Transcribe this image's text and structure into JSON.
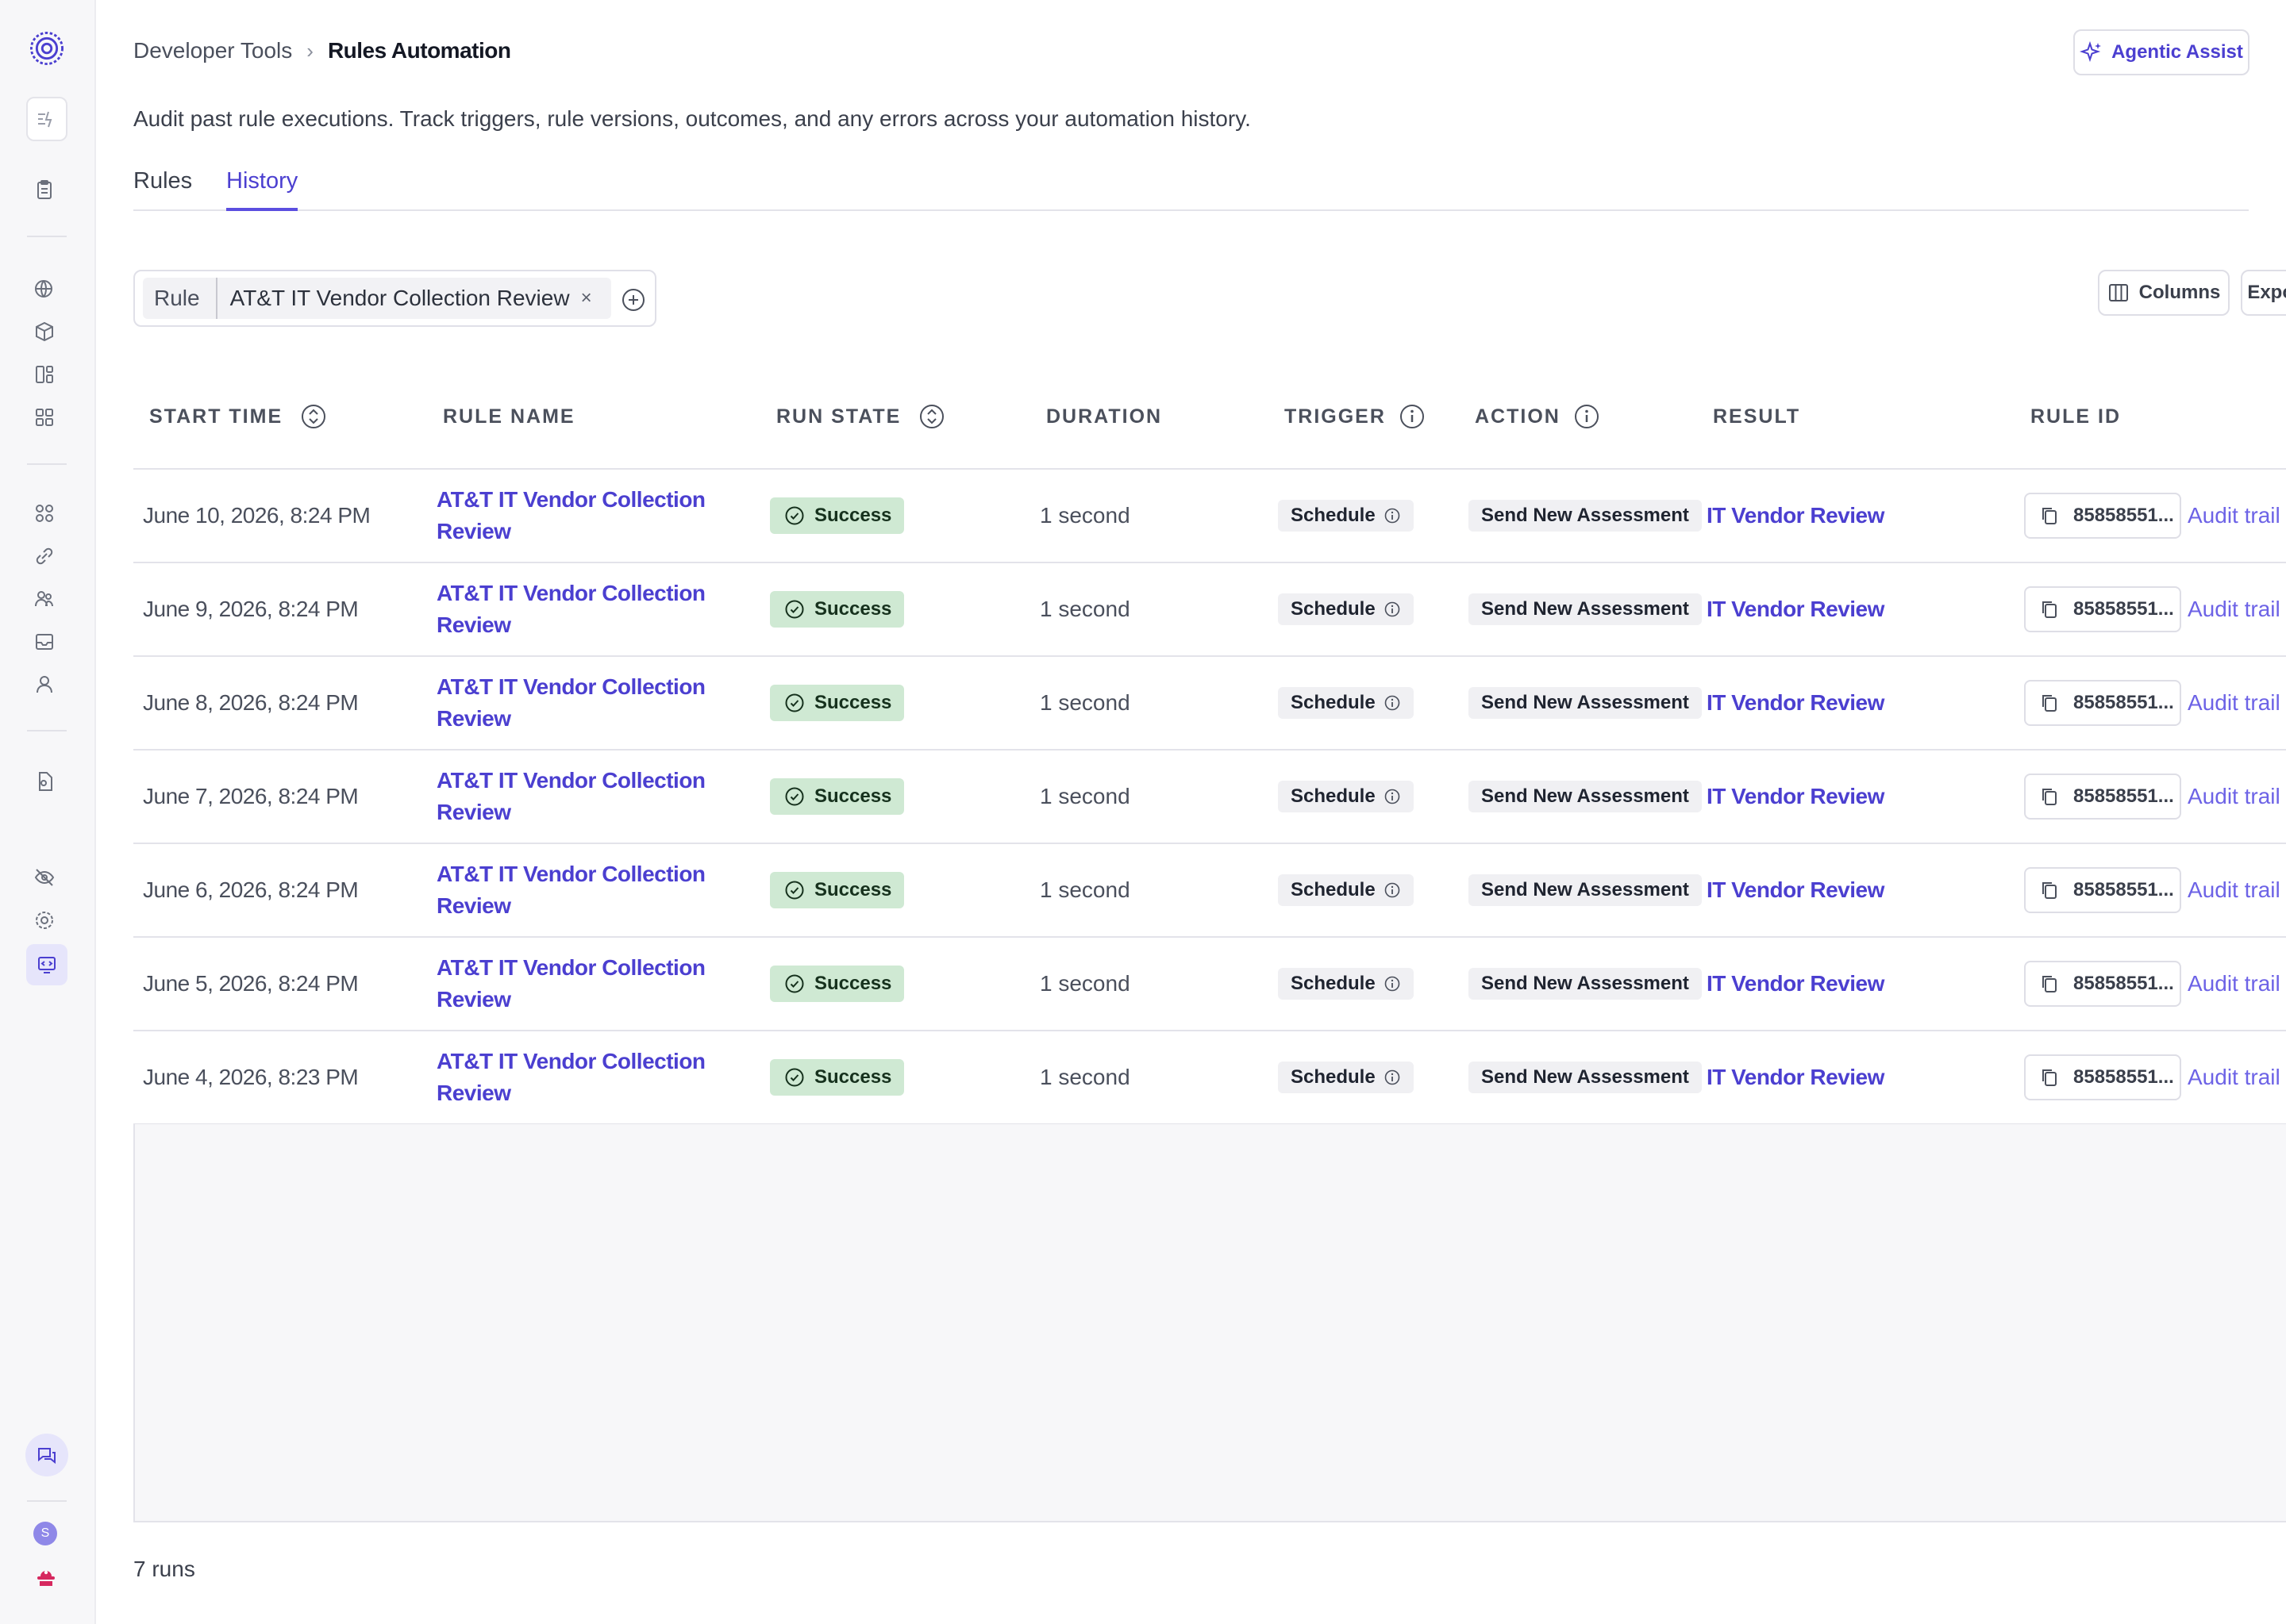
{
  "sidebar": {
    "icons": [
      "logo-icon",
      "automation-icon",
      "clipboard-icon",
      "globe-icon",
      "package-icon",
      "layout-icon",
      "grid-icon",
      "apps-icon",
      "link-icon",
      "people-icon",
      "inbox-icon",
      "user-icon",
      "document-icon",
      "eye-off-icon",
      "settings-icon",
      "developer-icon",
      "chat-icon"
    ],
    "avatar_initial": "S",
    "colors": {
      "active_bg": "#e6e5fb",
      "accent": "#4b3fd0",
      "avatar_bg": "#8f88e8",
      "support_icon": "#d6285f"
    }
  },
  "header": {
    "breadcrumb_parent": "Developer Tools",
    "breadcrumb_separator": "›",
    "breadcrumb_current": "Rules Automation",
    "agentic_label": "Agentic Assist"
  },
  "description": "Audit past rule executions. Track triggers, rule versions, outcomes, and any errors across your automation history.",
  "tabs": [
    {
      "label": "Rules",
      "active": false
    },
    {
      "label": "History",
      "active": true
    }
  ],
  "filter": {
    "key": "Rule",
    "value": "AT&T IT Vendor Collection Review",
    "remove": "×"
  },
  "toolbar": {
    "columns_label": "Columns",
    "export_label": "Export to CSV"
  },
  "table": {
    "headers": {
      "start_time": "START TIME",
      "rule_name": "RULE NAME",
      "run_state": "RUN STATE",
      "duration": "DURATION",
      "trigger": "TRIGGER",
      "action": "ACTION",
      "result": "RESULT",
      "rule_id": "RULE ID"
    },
    "rows": [
      {
        "start_time": "June 10, 2026, 8:24 PM",
        "rule_name_line1": "AT&T IT Vendor Collection",
        "rule_name_line2": "Review",
        "run_state": "Success",
        "duration": "1 second",
        "trigger": "Schedule",
        "action": "Send New Assessment",
        "result": "IT Vendor Review",
        "rule_id": "85858551...",
        "audit": "Audit trail"
      },
      {
        "start_time": "June 9, 2026, 8:24 PM",
        "rule_name_line1": "AT&T IT Vendor Collection",
        "rule_name_line2": "Review",
        "run_state": "Success",
        "duration": "1 second",
        "trigger": "Schedule",
        "action": "Send New Assessment",
        "result": "IT Vendor Review",
        "rule_id": "85858551...",
        "audit": "Audit trail"
      },
      {
        "start_time": "June 8, 2026, 8:24 PM",
        "rule_name_line1": "AT&T IT Vendor Collection",
        "rule_name_line2": "Review",
        "run_state": "Success",
        "duration": "1 second",
        "trigger": "Schedule",
        "action": "Send New Assessment",
        "result": "IT Vendor Review",
        "rule_id": "85858551...",
        "audit": "Audit trail"
      },
      {
        "start_time": "June 7, 2026, 8:24 PM",
        "rule_name_line1": "AT&T IT Vendor Collection",
        "rule_name_line2": "Review",
        "run_state": "Success",
        "duration": "1 second",
        "trigger": "Schedule",
        "action": "Send New Assessment",
        "result": "IT Vendor Review",
        "rule_id": "85858551...",
        "audit": "Audit trail"
      },
      {
        "start_time": "June 6, 2026, 8:24 PM",
        "rule_name_line1": "AT&T IT Vendor Collection",
        "rule_name_line2": "Review",
        "run_state": "Success",
        "duration": "1 second",
        "trigger": "Schedule",
        "action": "Send New Assessment",
        "result": "IT Vendor Review",
        "rule_id": "85858551...",
        "audit": "Audit trail"
      },
      {
        "start_time": "June 5, 2026, 8:24 PM",
        "rule_name_line1": "AT&T IT Vendor Collection",
        "rule_name_line2": "Review",
        "run_state": "Success",
        "duration": "1 second",
        "trigger": "Schedule",
        "action": "Send New Assessment",
        "result": "IT Vendor Review",
        "rule_id": "85858551...",
        "audit": "Audit trail"
      },
      {
        "start_time": "June 4, 2026, 8:23 PM",
        "rule_name_line1": "AT&T IT Vendor Collection",
        "rule_name_line2": "Review",
        "run_state": "Success",
        "duration": "1 second",
        "trigger": "Schedule",
        "action": "Send New Assessment",
        "result": "IT Vendor Review",
        "rule_id": "85858551...",
        "audit": "Audit trail"
      }
    ],
    "colors": {
      "success_bg": "#cfe9d3",
      "link": "#4b3fd0"
    }
  },
  "footer": {
    "run_count": "7 runs"
  }
}
